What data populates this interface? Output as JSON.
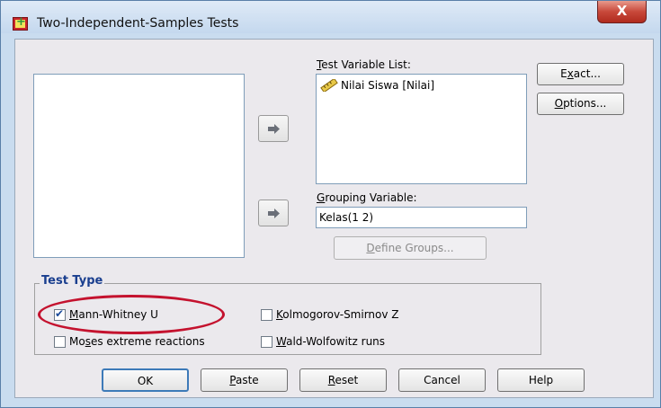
{
  "window": {
    "title": "Two-Independent-Samples Tests",
    "close_glyph": "X"
  },
  "test_variable": {
    "label_prefix": "",
    "label_mnemonic": "T",
    "label_rest": "est Variable List:",
    "items": [
      {
        "label": "Nilai Siswa [Nilai]",
        "icon": "ruler-icon"
      }
    ]
  },
  "grouping_variable": {
    "label_mnemonic": "G",
    "label_rest": "rouping Variable:",
    "value": "Kelas(1 2)"
  },
  "define_groups": {
    "mnemonic": "D",
    "rest": "efine Groups..."
  },
  "side_buttons": {
    "exact": {
      "pre": "E",
      "mnemonic": "x",
      "rest": "act..."
    },
    "options": {
      "pre": "",
      "mnemonic": "O",
      "rest": "ptions..."
    }
  },
  "test_type": {
    "title": "Test Type",
    "options": [
      {
        "pre": "",
        "mnemonic": "M",
        "rest": "ann-Whitney U",
        "checked": true
      },
      {
        "pre": "",
        "mnemonic": "K",
        "rest": "olmogorov-Smirnov Z",
        "checked": false
      },
      {
        "pre": "Mo",
        "mnemonic": "s",
        "rest": "es extreme reactions",
        "checked": false
      },
      {
        "pre": "",
        "mnemonic": "W",
        "rest": "ald-Wolfowitz runs",
        "checked": false
      }
    ]
  },
  "bottom_buttons": {
    "ok": "OK",
    "paste": {
      "mnemonic": "P",
      "rest": "aste"
    },
    "reset": {
      "mnemonic": "R",
      "rest": "eset"
    },
    "cancel": "Cancel",
    "help": "Help"
  },
  "colors": {
    "highlight": "#c4122e",
    "group_title": "#1a3f8f"
  }
}
